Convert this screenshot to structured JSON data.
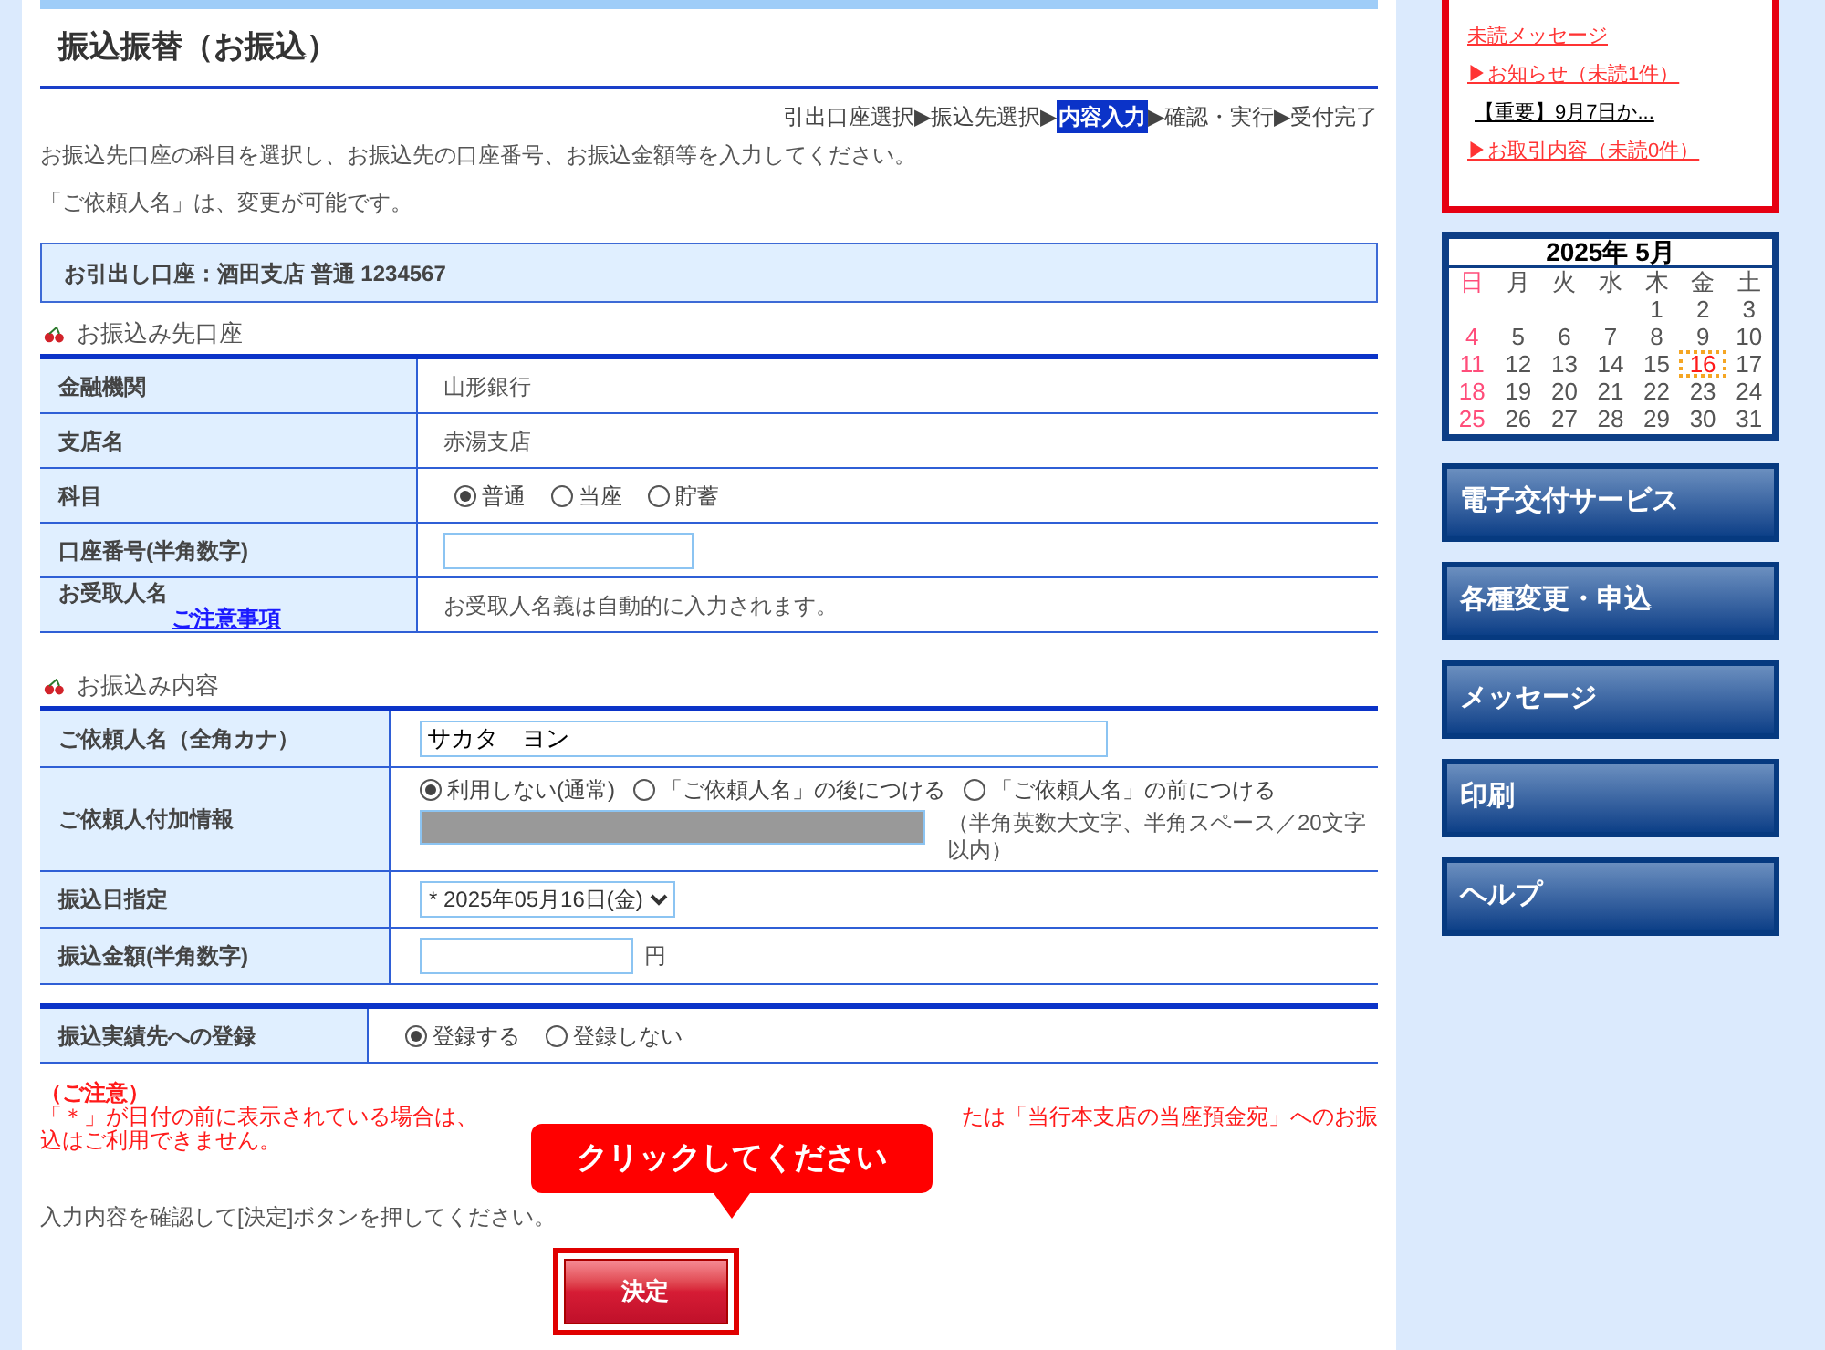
{
  "page_title": "振込振替（お振込）",
  "steps": [
    {
      "label": "引出口座選択",
      "selected": false
    },
    {
      "label": "振込先選択",
      "selected": false
    },
    {
      "label": "内容入力",
      "selected": true
    },
    {
      "label": "確認・実行",
      "selected": false
    },
    {
      "label": "受付完了",
      "selected": false
    }
  ],
  "step_separators": [
    "▶",
    "▶",
    "▶",
    "▶"
  ],
  "instructions": [
    "お振込先口座の科目を選択し、お振込先の口座番号、お振込金額等を入力してください。",
    "「ご依頼人名」は、変更が可能です。"
  ],
  "source_account": "お引出し口座：酒田支店 普通 1234567",
  "sections": [
    {
      "heading": "お振込み先口座",
      "rows": [
        {
          "label": "金融機関",
          "kind": "text",
          "value": "山形銀行"
        },
        {
          "label": "支店名",
          "kind": "text",
          "value": "赤湯支店"
        },
        {
          "label": "科目",
          "kind": "radio",
          "options": [
            {
              "label": "普通",
              "selected": true
            },
            {
              "label": "当座",
              "selected": false
            },
            {
              "label": "貯蓄",
              "selected": false
            }
          ]
        },
        {
          "label": "口座番号(半角数字)",
          "kind": "input"
        },
        {
          "label": "お受取人名",
          "link": "ご注意事項",
          "kind": "text",
          "value": "お受取人名義は自動的に入力されます。"
        }
      ]
    },
    {
      "heading": "お振込み内容",
      "rows": [
        {
          "label": "ご依頼人名（全角カナ）",
          "kind": "input_wide",
          "value": "サカタ　ヨン"
        },
        {
          "label": "ご依頼人付加情報",
          "kind": "radio_masked",
          "options": [
            {
              "label": "利用しない(通常)",
              "selected": true
            },
            {
              "label": "「ご依頼人名」の後につける",
              "selected": false
            },
            {
              "label": "「ご依頼人名」の前につける",
              "selected": false
            }
          ],
          "note": "（半角英数大文字、半角スペース／20文字以内）"
        },
        {
          "label": "振込日指定",
          "kind": "select",
          "value": "* 2025年05月16日(金)"
        },
        {
          "label": "振込金額(半角数字)",
          "kind": "input",
          "suffix": "円"
        }
      ]
    },
    {
      "rows": [
        {
          "label": "振込実績先への登録",
          "kind": "radio",
          "options": [
            {
              "label": "登録する",
              "selected": true
            },
            {
              "label": "登録しない",
              "selected": false
            }
          ]
        }
      ]
    }
  ],
  "notice": {
    "title": "（ご注意）",
    "line_1_start": "「＊」が日付の前に表示されている場合は、",
    "line_1_end": "たは「当行本支店の当座預金宛」へのお振",
    "line_2": "込はご利用できません。"
  },
  "confirm_instruction": "入力内容を確認して[決定]ボタンを押してください。",
  "submit_button": "決定",
  "tooltip": "クリックしてください",
  "messages": [
    {
      "kind": "heading",
      "text": "未読メッセージ"
    },
    {
      "kind": "link",
      "text": "▶お知らせ（未読1件）"
    },
    {
      "kind": "item",
      "text": "【重要】9月7日か..."
    },
    {
      "kind": "link",
      "text": "▶お取引内容（未読0件）"
    }
  ],
  "calendar": {
    "title": "2025年 5月",
    "weekdays": [
      "日",
      "月",
      "火",
      "水",
      "木",
      "金",
      "土"
    ],
    "weeks": [
      [
        {
          "day": "1",
          "selected": false
        },
        {
          "day": "2",
          "selected": false
        },
        {
          "day": "3",
          "selected": false
        }
      ],
      [
        {
          "day": "4",
          "selected": false
        },
        {
          "day": "5",
          "selected": false
        },
        {
          "day": "6",
          "selected": false
        },
        {
          "day": "7",
          "selected": false
        },
        {
          "day": "8",
          "selected": false
        },
        {
          "day": "9",
          "selected": false
        },
        {
          "day": "10",
          "selected": false
        }
      ],
      [
        {
          "day": "11",
          "selected": false
        },
        {
          "day": "12",
          "selected": false
        },
        {
          "day": "13",
          "selected": false
        },
        {
          "day": "14",
          "selected": false
        },
        {
          "day": "15",
          "selected": false
        },
        {
          "day": "16",
          "selected": true
        },
        {
          "day": "17",
          "selected": false
        }
      ],
      [
        {
          "day": "18",
          "selected": false
        },
        {
          "day": "19",
          "selected": false
        },
        {
          "day": "20",
          "selected": false
        },
        {
          "day": "21",
          "selected": false
        },
        {
          "day": "22",
          "selected": false
        },
        {
          "day": "23",
          "selected": false
        },
        {
          "day": "24",
          "selected": false
        }
      ],
      [
        {
          "day": "25",
          "selected": false
        },
        {
          "day": "26",
          "selected": false
        },
        {
          "day": "27",
          "selected": false
        },
        {
          "day": "28",
          "selected": false
        },
        {
          "day": "29",
          "selected": false
        },
        {
          "day": "30",
          "selected": false
        },
        {
          "day": "31",
          "selected": false
        }
      ]
    ]
  },
  "nav_buttons": [
    "電子交付サービス",
    "各種変更・申込",
    "メッセージ",
    "印刷",
    "ヘルプ"
  ]
}
